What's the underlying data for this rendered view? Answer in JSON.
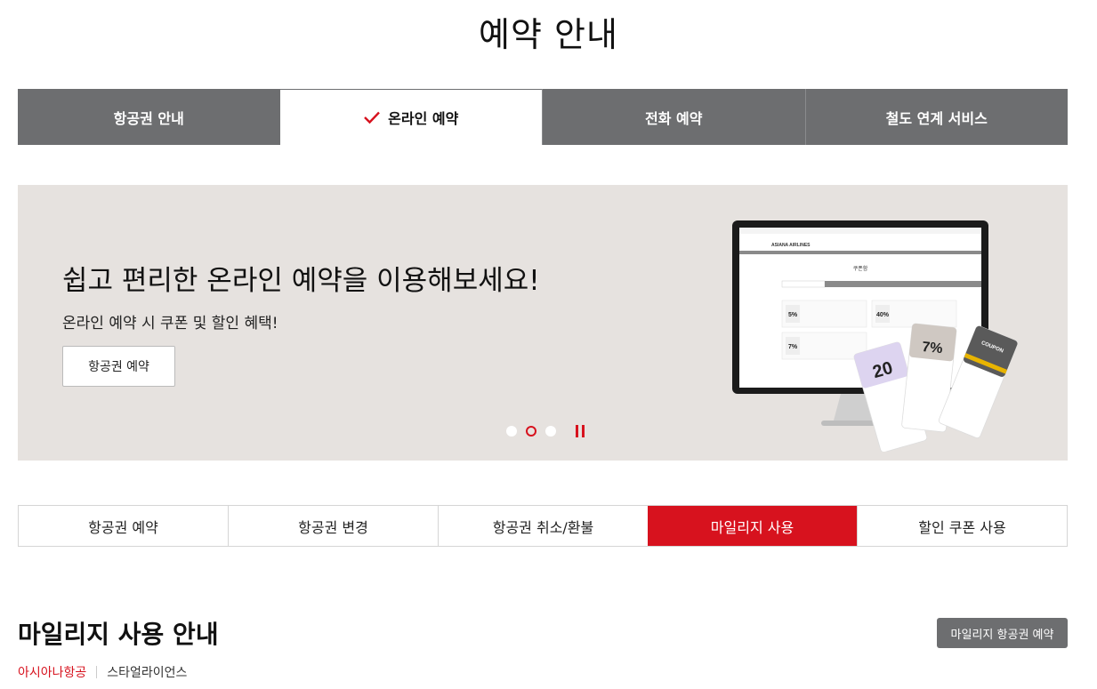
{
  "page": {
    "title": "예약 안내"
  },
  "main_tabs": [
    {
      "label": "항공권 안내"
    },
    {
      "label": "온라인 예약"
    },
    {
      "label": "전화 예약"
    },
    {
      "label": "철도 연계 서비스"
    }
  ],
  "banner": {
    "headline": "쉽고 편리한 온라인 예약을 이용해보세요!",
    "subtext": "온라인 예약 시 쿠폰 및 할인 혜택!",
    "button_label": "항공권 예약",
    "slide_count": 3,
    "active_slide": 2,
    "illustration": {
      "brand": "ASIANA AIRLINES",
      "screen_title": "쿠폰함",
      "coupons": [
        "5%",
        "40%",
        "7%",
        "20",
        "7%"
      ],
      "coupon_word": "COUPON"
    }
  },
  "sub_tabs": [
    {
      "label": "항공권 예약"
    },
    {
      "label": "항공권 변경"
    },
    {
      "label": "항공권 취소/환불"
    },
    {
      "label": "마일리지 사용"
    },
    {
      "label": "할인 쿠폰 사용"
    }
  ],
  "section": {
    "title": "마일리지 사용 안내",
    "button_label": "마일리지 항공권 예약",
    "filters": [
      {
        "label": "아시아나항공"
      },
      {
        "label": "스타얼라이언스"
      }
    ]
  },
  "colors": {
    "accent_red": "#d7121e",
    "tab_gray": "#6d6e70",
    "banner_bg": "#e6e2df"
  }
}
